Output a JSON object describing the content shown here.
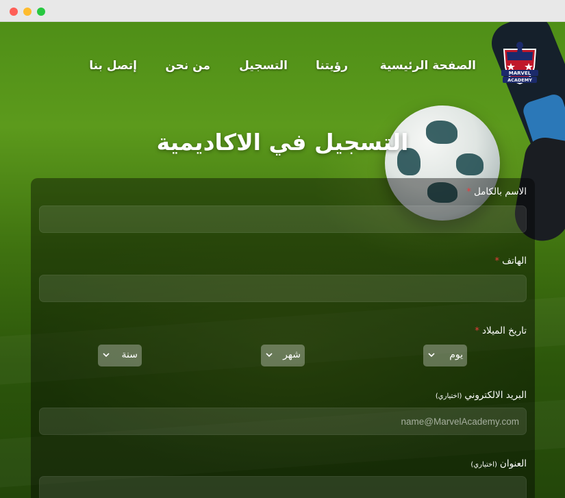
{
  "nav": {
    "home": "الصفحة الرئيسية",
    "vision": "رؤيتنا",
    "register": "التسجيل",
    "about": "من نحن",
    "contact": "إتصل بنا"
  },
  "logo": {
    "text": "MARVEL ACADEMY",
    "icon": "academy-crest-icon"
  },
  "page": {
    "title": "التسجيل في الاكاديمية"
  },
  "form": {
    "full_name": {
      "label": "الاسم بالكامل",
      "required_mark": "*",
      "value": ""
    },
    "phone": {
      "label": "الهاتف",
      "required_mark": "*",
      "value": ""
    },
    "birth_date": {
      "label": "تاريخ الميلاد",
      "required_mark": "*",
      "day": "يوم",
      "month": "شهر",
      "year": "سنة"
    },
    "email": {
      "label": "البريد الالكتروني",
      "optional": "(اختياري)",
      "placeholder": "name@MarvelAcademy.com",
      "value": ""
    },
    "address": {
      "label": "العنوان",
      "optional": "(اختياري)",
      "value": ""
    }
  },
  "colors": {
    "required": "#e63c3c",
    "text": "#ffffff",
    "form_bg": "rgba(0,0,0,0.40)"
  }
}
